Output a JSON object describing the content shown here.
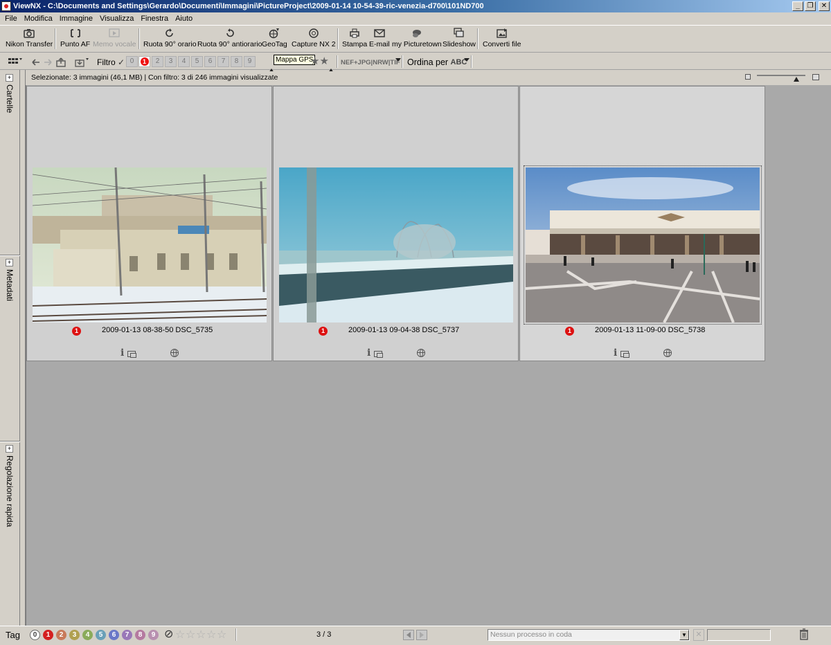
{
  "window": {
    "title": "ViewNX - C:\\Documents and Settings\\Gerardo\\Documenti\\Immagini\\PictureProject\\2009-01-14 10-54-39-ric-venezia-d700\\101ND700",
    "minimize": "_",
    "maximize": "❐",
    "close": "✕"
  },
  "menu": [
    "File",
    "Modifica",
    "Immagine",
    "Visualizza",
    "Finestra",
    "Aiuto"
  ],
  "toolbar": {
    "items": [
      {
        "label": "Nikon Transfer",
        "icon": "camera-icon"
      },
      {
        "label": "Punto AF",
        "icon": "af-point-icon"
      },
      {
        "label": "Memo vocale",
        "icon": "voice-memo-icon",
        "disabled": true
      },
      {
        "label": "Ruota 90° orario",
        "icon": "rotate-cw-icon"
      },
      {
        "label": "Ruota 90° antiorario",
        "icon": "rotate-ccw-icon"
      },
      {
        "label": "GeoTag",
        "icon": "geotag-icon"
      },
      {
        "label": "Capture NX 2",
        "icon": "capture-nx-icon"
      },
      {
        "label": "Stampa",
        "icon": "print-icon"
      },
      {
        "label": "E-mail",
        "icon": "email-icon"
      },
      {
        "label": "my Picturetown",
        "icon": "picturetown-icon"
      },
      {
        "label": "Slideshow",
        "icon": "slideshow-icon"
      },
      {
        "label": "Converti file",
        "icon": "convert-icon"
      }
    ]
  },
  "filterbar": {
    "filter_label": "Filtro",
    "check": "✓",
    "numbers": [
      "0",
      "1",
      "2",
      "3",
      "4",
      "5",
      "6",
      "7",
      "8",
      "9"
    ],
    "active_number": "1",
    "tooltip": "Mappa GPS",
    "stars": "★★",
    "filetypes": "NEF+JPG|NRW|TIF",
    "sort_label": "Ordina per",
    "sort_value": "ABC"
  },
  "sidepanel": {
    "tabs": [
      "Cartelle",
      "Metadati",
      "Regolazione rapida"
    ],
    "plus": "+"
  },
  "selection_status": "Selezionate: 3 immagini (46,1 MB) | Con filtro: 3 di 246 immagini visualizzate",
  "thumbnails": [
    {
      "label": "1",
      "caption": "2009-01-13 08-38-50 DSC_5735",
      "info": "i",
      "selected": false
    },
    {
      "label": "1",
      "caption": "2009-01-13 09-04-38 DSC_5737",
      "info": "i",
      "selected": false
    },
    {
      "label": "1",
      "caption": "2009-01-13 11-09-00 DSC_5738",
      "info": "i",
      "selected": true
    }
  ],
  "bottombar": {
    "tag_label": "Tag",
    "label_numbers": [
      "0",
      "1",
      "2",
      "3",
      "4",
      "5",
      "6",
      "7",
      "8",
      "9"
    ],
    "label_colors": [
      "#ffffff",
      "#d42020",
      "#c87a5a",
      "#b0a050",
      "#8aab5a",
      "#6aa0b8",
      "#6a78c8",
      "#9a78b8",
      "#b57aa0",
      "#b890b0"
    ],
    "no_rating": "⃠",
    "stars": [
      "☆",
      "☆",
      "☆",
      "☆",
      "☆"
    ],
    "page_counter": "3 / 3",
    "queue_text": "Nessun processo in coda"
  }
}
